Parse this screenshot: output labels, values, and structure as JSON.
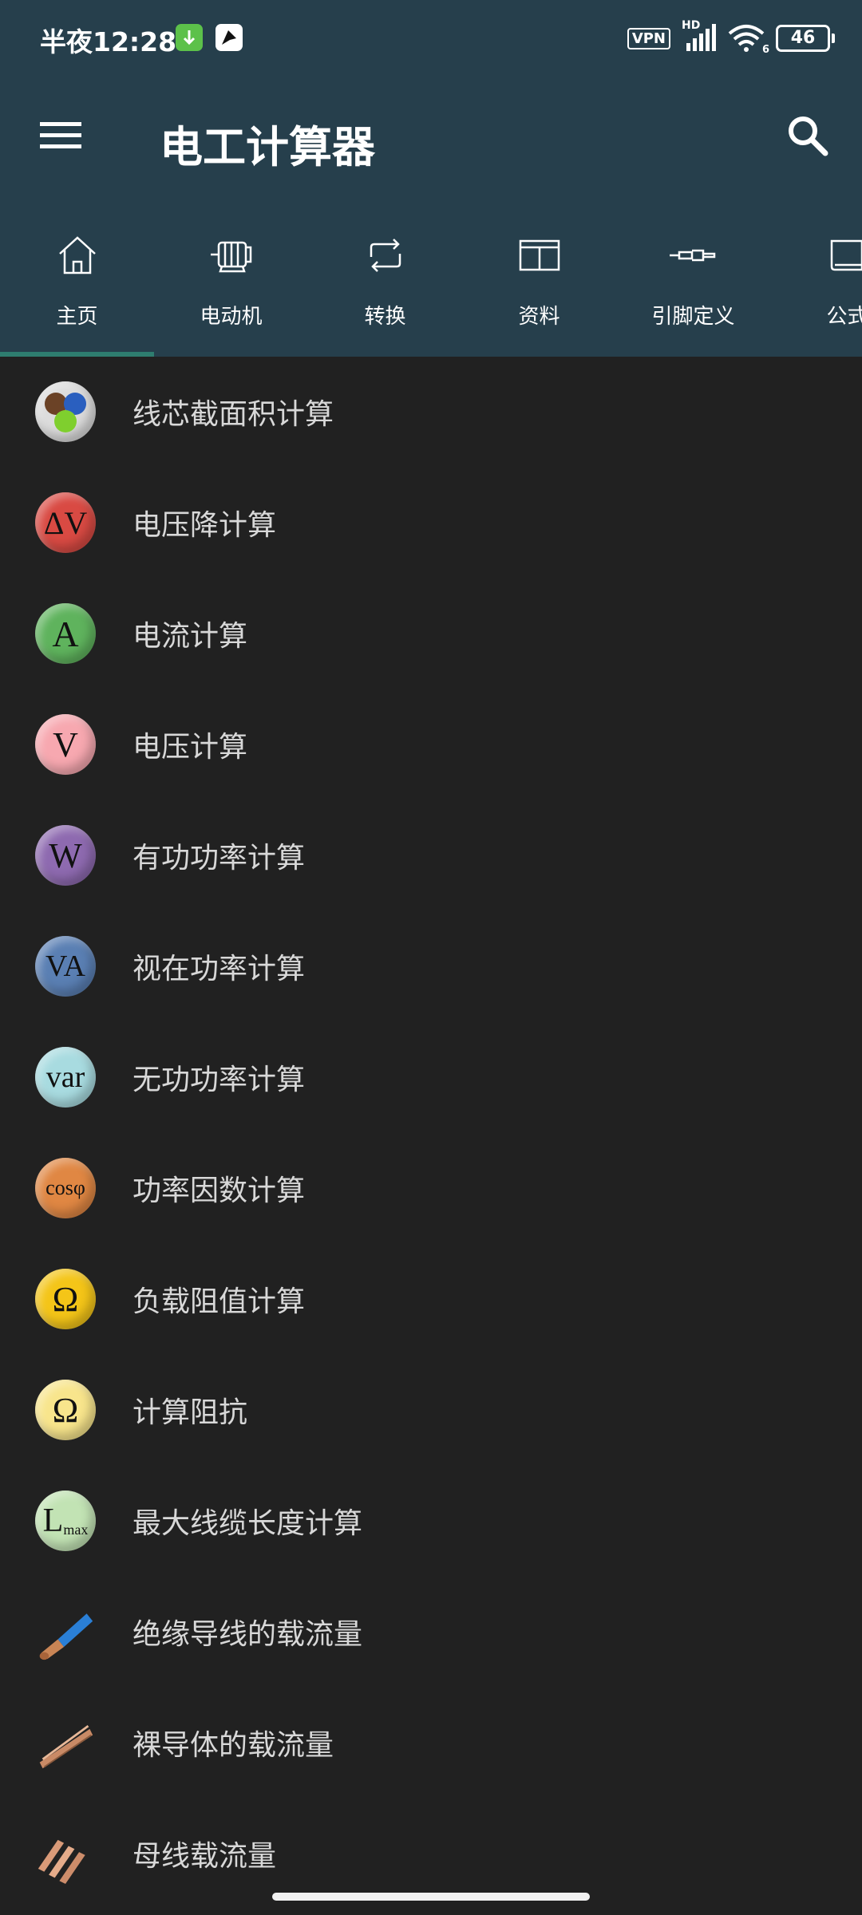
{
  "status": {
    "time": "半夜12:28",
    "vpn": "VPN",
    "hd": "HD",
    "wifi_sub": "6",
    "battery": "46"
  },
  "toolbar": {
    "title": "电工计算器"
  },
  "tabs": [
    {
      "label": "主页",
      "icon": "home-icon"
    },
    {
      "label": "电动机",
      "icon": "motor-icon"
    },
    {
      "label": "转换",
      "icon": "repeat-icon"
    },
    {
      "label": "资料",
      "icon": "book-open-icon"
    },
    {
      "label": "引脚定义",
      "icon": "connector-icon"
    },
    {
      "label": "公式",
      "icon": "book-icon"
    }
  ],
  "items": [
    {
      "label": "线芯截面积计算",
      "symbol": "",
      "icon": "wire-cores-icon",
      "color": "#dcdcdc"
    },
    {
      "label": "电压降计算",
      "symbol": "ΔV",
      "icon": "voltage-drop-icon",
      "color": "#d94a43"
    },
    {
      "label": "电流计算",
      "symbol": "A",
      "icon": "current-icon",
      "color": "#5fb35d"
    },
    {
      "label": "电压计算",
      "symbol": "V",
      "icon": "voltage-icon",
      "color": "#f7a8b0"
    },
    {
      "label": "有功功率计算",
      "symbol": "W",
      "icon": "active-power-icon",
      "color": "#8e6ab0"
    },
    {
      "label": "视在功率计算",
      "symbol": "VA",
      "icon": "apparent-power-icon",
      "color": "#5a7fb3"
    },
    {
      "label": "无功功率计算",
      "symbol": "var",
      "icon": "reactive-power-icon",
      "color": "#a8dbe0"
    },
    {
      "label": "功率因数计算",
      "symbol": "cosφ",
      "icon": "power-factor-icon",
      "color": "#e08743"
    },
    {
      "label": "负载阻值计算",
      "symbol": "Ω",
      "icon": "load-resistance-icon",
      "color": "#f4c518"
    },
    {
      "label": "计算阻抗",
      "symbol": "Ω",
      "icon": "impedance-icon",
      "color": "#f8e58c"
    },
    {
      "label": "最大线缆长度计算",
      "symbol": "L",
      "symbol_sub": "max",
      "icon": "max-cable-length-icon",
      "color": "#c2e3b4"
    },
    {
      "label": "绝缘导线的载流量",
      "symbol": "",
      "icon": "insulated-wire-icon",
      "color": "#212121"
    },
    {
      "label": "裸导体的载流量",
      "symbol": "",
      "icon": "bare-conductor-icon",
      "color": "#212121"
    },
    {
      "label": "母线载流量",
      "symbol": "",
      "icon": "busbar-icon",
      "color": "#212121"
    }
  ]
}
